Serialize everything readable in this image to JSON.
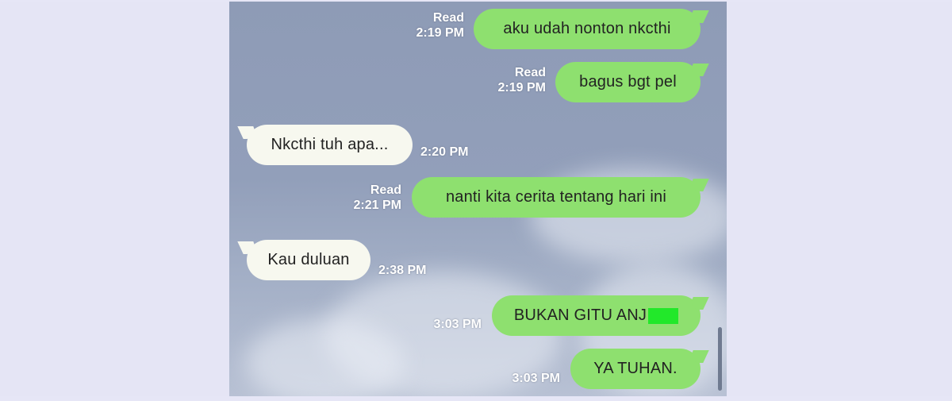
{
  "messages": [
    {
      "direction": "outgoing",
      "text": "aku udah nonton nkcthi",
      "status": "Read",
      "time": "2:19 PM"
    },
    {
      "direction": "outgoing",
      "text": "bagus bgt pel",
      "status": "Read",
      "time": "2:19 PM"
    },
    {
      "direction": "incoming",
      "text": "Nkcthi tuh apa...",
      "time": "2:20 PM"
    },
    {
      "direction": "outgoing",
      "text": "nanti kita cerita tentang hari ini",
      "status": "Read",
      "time": "2:21 PM"
    },
    {
      "direction": "incoming",
      "text": "Kau duluan",
      "time": "2:38 PM"
    },
    {
      "direction": "outgoing",
      "text": "BUKAN GITU ANJ",
      "censored_suffix": true,
      "time": "3:03 PM"
    },
    {
      "direction": "outgoing",
      "text": "YA TUHAN.",
      "time": "3:03 PM"
    }
  ],
  "colors": {
    "outgoing_bubble": "#8ee06f",
    "incoming_bubble": "#f7f8ef",
    "chat_background": "#929fba",
    "censor_block": "#22e82a",
    "page_background": "#e6e6f6"
  }
}
